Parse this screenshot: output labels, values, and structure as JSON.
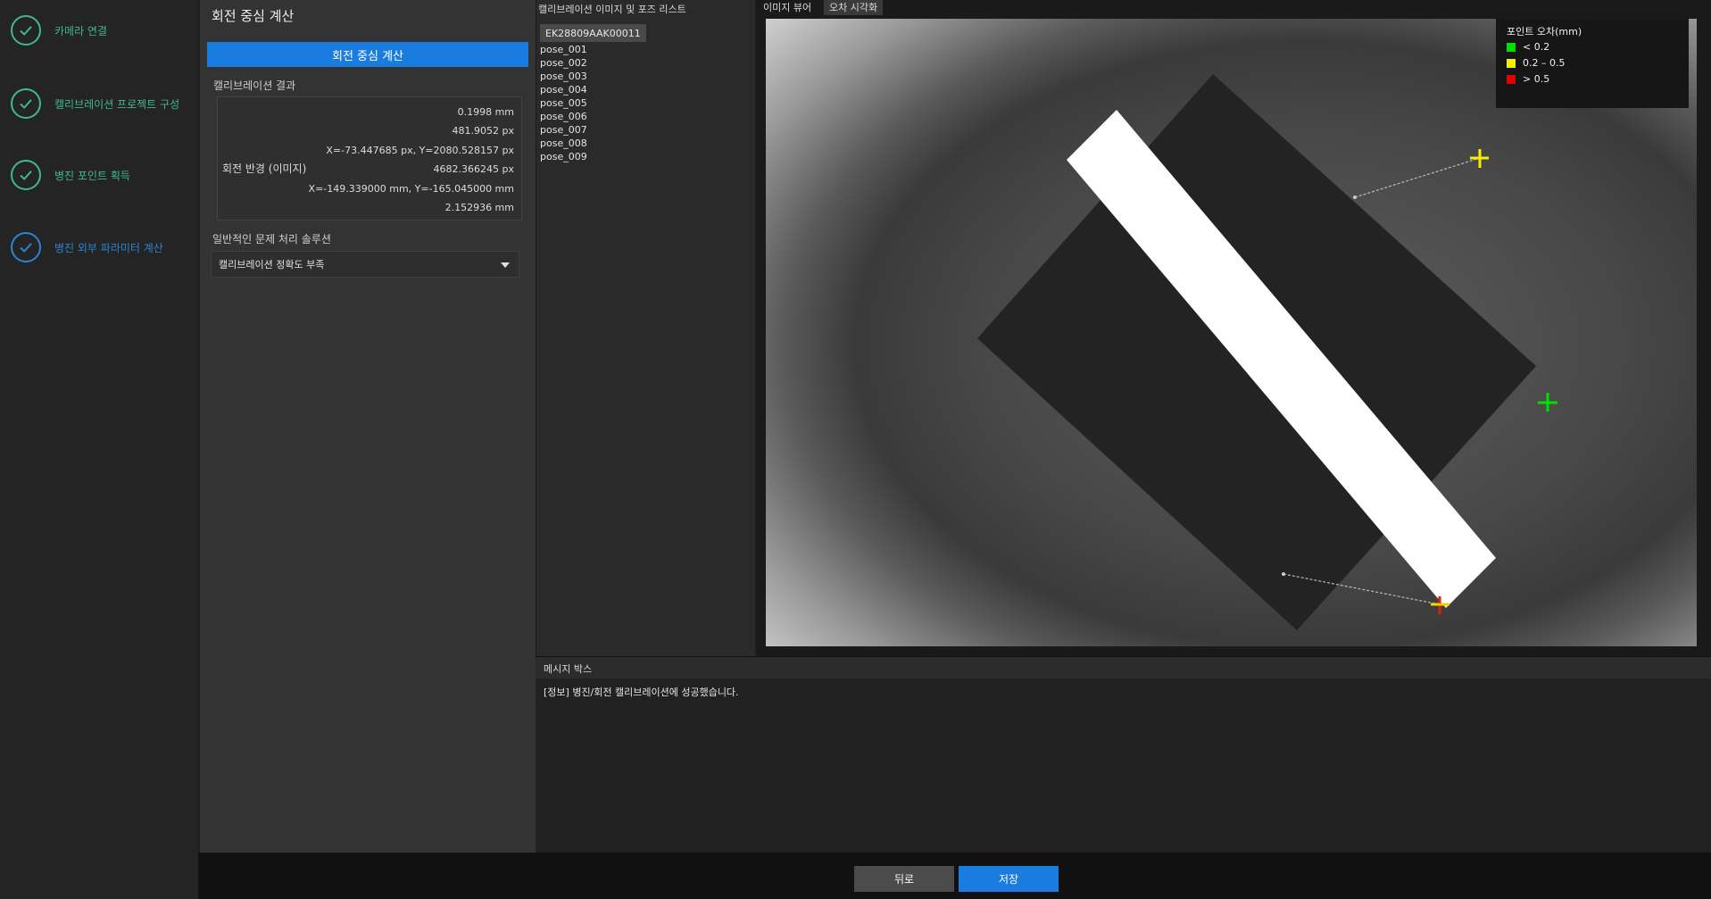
{
  "steps": [
    {
      "label": "카메라 연결",
      "status": "done"
    },
    {
      "label": "캘리브레이션 프로젝트 구성",
      "status": "done"
    },
    {
      "label": "병진 포인트 획득",
      "status": "done"
    },
    {
      "label": "병진 외부 파라미터 계산",
      "status": "active"
    }
  ],
  "panel": {
    "title": "회전 중심 계산",
    "calc_button": "회전 중심 계산",
    "result_title": "캘리브레이션 결과",
    "result_values": [
      "0.1998 mm",
      "481.9052 px",
      "X=-73.447685 px, Y=2080.528157 px",
      "4682.366245 px",
      "X=-149.339000 mm, Y=-165.045000 mm",
      "2.152936 mm"
    ],
    "radius_label": "회전 반경 (이미지)",
    "troubleshoot_title": "일반적인 문제 처리 솔루션",
    "troubleshoot_selected": "캘리브레이션 정확도 부족"
  },
  "pose_panel": {
    "title": "캘리브레이션 이미지 및 포즈 리스트",
    "device": "EK28809AAK00011",
    "poses": [
      "pose_001",
      "pose_002",
      "pose_003",
      "pose_004",
      "pose_005",
      "pose_006",
      "pose_007",
      "pose_008",
      "pose_009"
    ]
  },
  "viewer": {
    "tabs": [
      "이미지 뷰어",
      "오차 시각화"
    ],
    "legend_title": "포인트 오차(mm)",
    "legend": [
      {
        "label": "< 0.2",
        "color": "#00e000"
      },
      {
        "label": "0.2 – 0.5",
        "color": "#f5f000"
      },
      {
        "label": "> 0.5",
        "color": "#e00000"
      }
    ]
  },
  "message_box": {
    "title": "메시지 박스",
    "text": "[정보] 병진/회전 캘리브레이션에 성공했습니다."
  },
  "footer": {
    "back": "뒤로",
    "save": "저장"
  }
}
